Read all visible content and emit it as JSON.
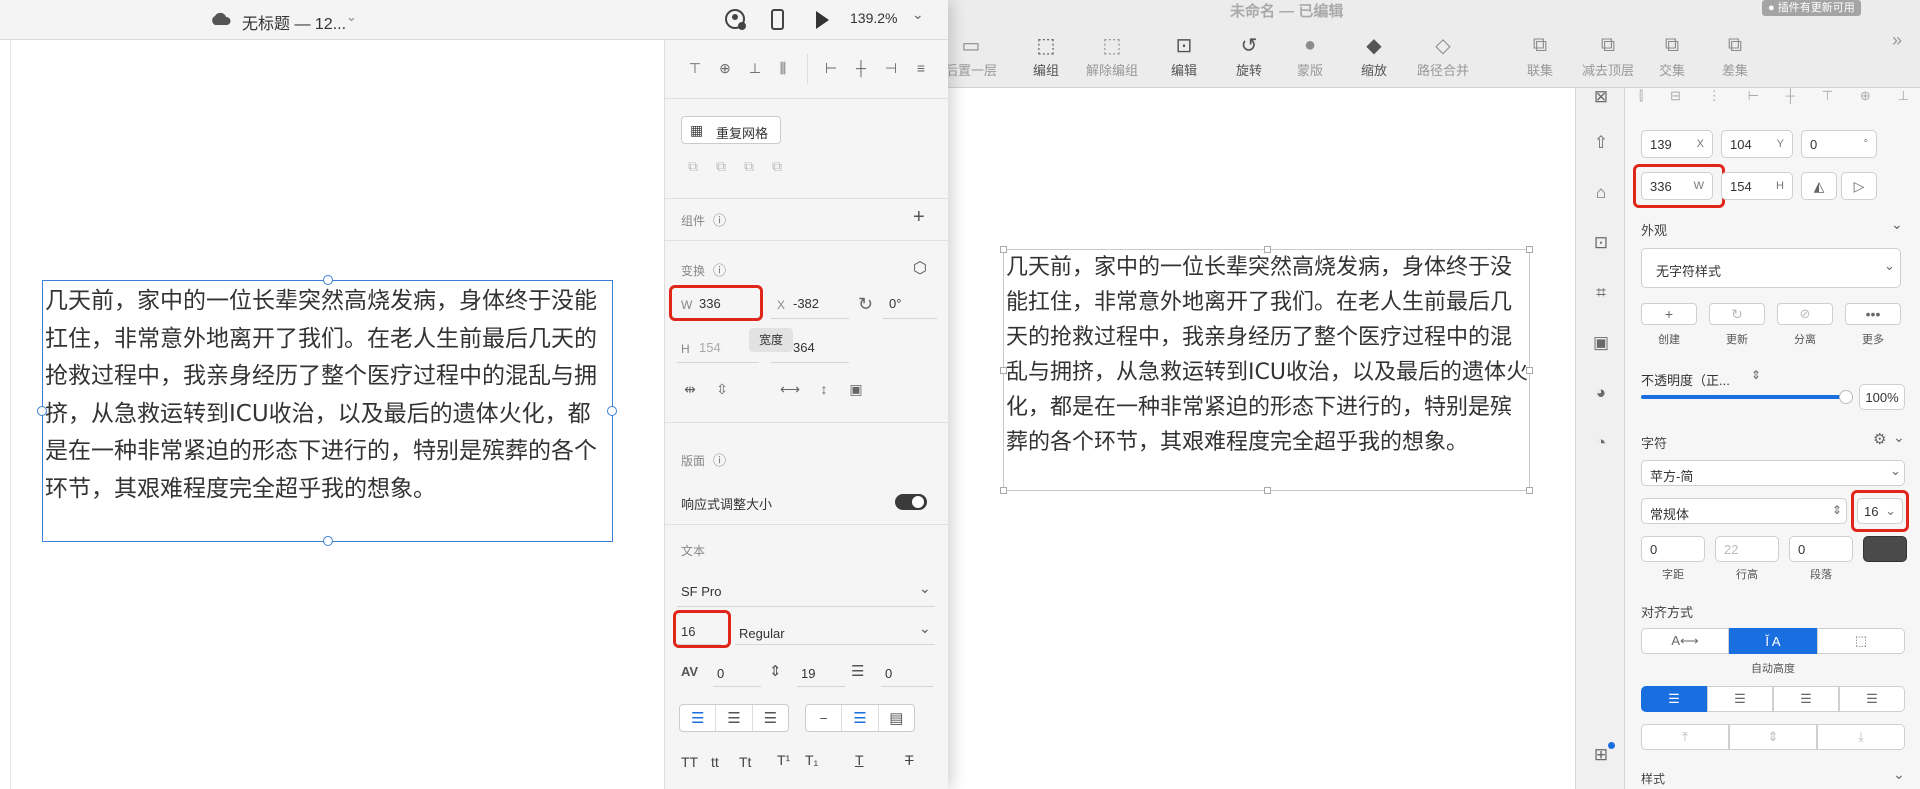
{
  "left": {
    "title": "无标题 — 12...",
    "zoom": "139.2%",
    "repeat_grid": "重复网格",
    "components": "组件",
    "transform": "变换",
    "w_label": "W",
    "w_value": "336",
    "x_label": "X",
    "x_value": "-382",
    "rotation": "0°",
    "tooltip": "宽度",
    "h_label": "H",
    "h_value": "154",
    "y_value": "364",
    "layout": "版面",
    "responsive": "响应式调整大小",
    "text_section": "文本",
    "font_family": "SF Pro",
    "font_size": "16",
    "font_weight": "Regular",
    "char_spacing": "0",
    "line_spacing": "19",
    "para_spacing": "0",
    "case_labels": [
      "TT",
      "tt",
      "Tt"
    ]
  },
  "body_text": "几天前，家中的一位长辈突然高烧发病，身体终于没能扛住，非常意外地离开了我们。在老人生前最后几天的抢救过程中，我亲身经历了整个医疗过程中的混乱与拥挤，从急救运转到ICU收治，以及最后的遗体火化，都是在一种非常紧迫的形态下进行的，特别是殡葬的各个环节，其艰难程度完全超乎我的想象。",
  "right": {
    "title": "未命名 — 已编辑",
    "plugin_badge": "● 插件有更新可用",
    "toolbar": [
      "后置一层",
      "编组",
      "解除编组",
      "编辑",
      "旋转",
      "蒙版",
      "缩放",
      "路径合并",
      "联集",
      "减去顶层",
      "交集",
      "差集"
    ],
    "x_value": "139",
    "x_label": "X",
    "y_value": "104",
    "y_label": "Y",
    "rot_value": "0",
    "rot_label": "°",
    "w_value": "336",
    "w_label": "W",
    "h_value": "154",
    "h_label": "H",
    "appearance": "外观",
    "no_style": "无字符样式",
    "style_actions": [
      "创建",
      "更新",
      "分离",
      "更多"
    ],
    "opacity_label": "不透明度（正...",
    "opacity_value": "100%",
    "character": "字符",
    "font_family": "苹方-简",
    "font_weight": "常规体",
    "font_size": "16",
    "char_spacing": "0",
    "line_height": "22",
    "para_spacing": "0",
    "spacing_labels": [
      "字距",
      "行高",
      "段落"
    ],
    "alignment": "对齐方式",
    "auto_height": "自动高度",
    "style_label": "样式"
  }
}
